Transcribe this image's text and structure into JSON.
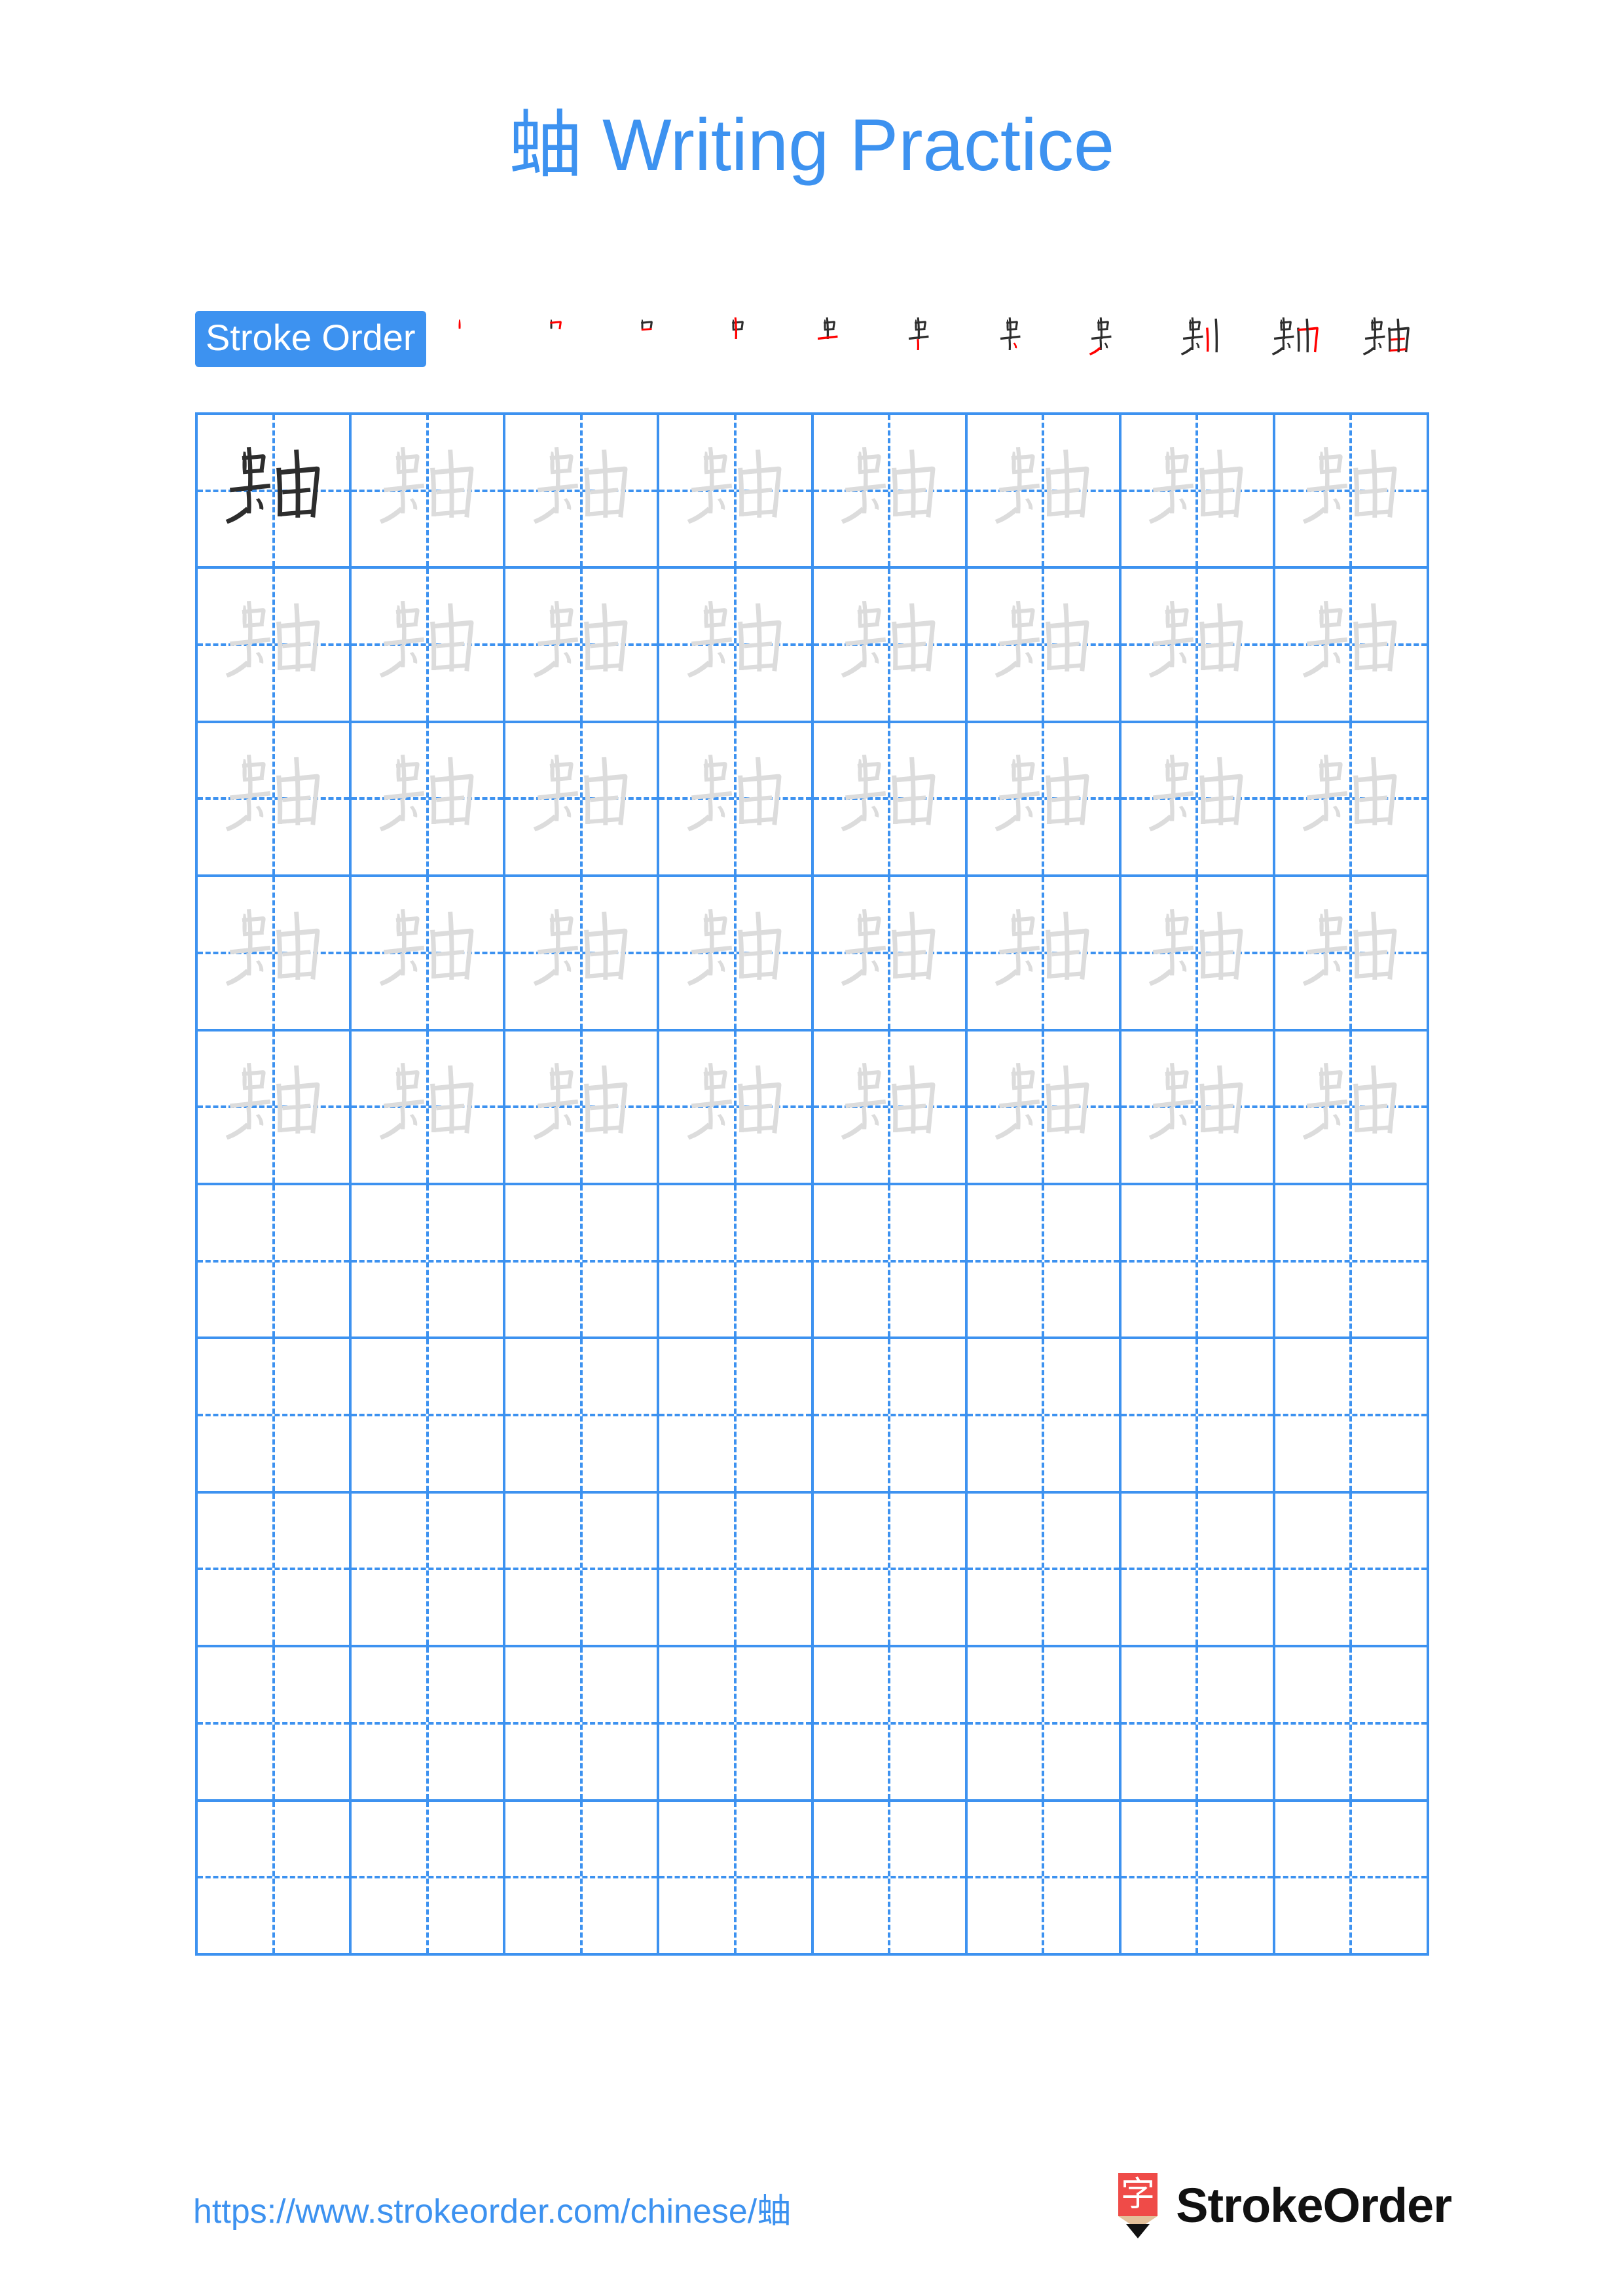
{
  "page": {
    "character": "蚰",
    "title": "蚰 Writing Practice",
    "title_char": "蚰",
    "title_rest": " Writing Practice",
    "background_color": "#ffffff",
    "accent_color": "#3D92F0",
    "trace_color": "#DCDCDC",
    "ink_color": "#2D2D2D",
    "highlight_stroke_color": "#FF0000"
  },
  "stroke_order": {
    "badge_label": "Stroke Order",
    "total_strokes": 11,
    "steps": [
      {
        "index": 1,
        "strokes_shown": 1,
        "new_stroke": 1,
        "glyph": "丨"
      },
      {
        "index": 2,
        "strokes_shown": 2,
        "new_stroke": 2,
        "glyph": "冂"
      },
      {
        "index": 3,
        "strokes_shown": 3,
        "new_stroke": 3,
        "glyph": "口"
      },
      {
        "index": 4,
        "strokes_shown": 4,
        "new_stroke": 4,
        "glyph": "中"
      },
      {
        "index": 5,
        "strokes_shown": 5,
        "new_stroke": 5,
        "glyph": "virtual-5"
      },
      {
        "index": 6,
        "strokes_shown": 6,
        "new_stroke": 6,
        "glyph": "虫"
      },
      {
        "index": 7,
        "strokes_shown": 7,
        "new_stroke": 7,
        "glyph": "虫丶"
      },
      {
        "index": 8,
        "strokes_shown": 8,
        "new_stroke": 8,
        "glyph": "蚰-8"
      },
      {
        "index": 9,
        "strokes_shown": 9,
        "new_stroke": 9,
        "glyph": "蚰-9"
      },
      {
        "index": 10,
        "strokes_shown": 10,
        "new_stroke": 10,
        "glyph": "蚰-10"
      },
      {
        "index": 11,
        "strokes_shown": 11,
        "new_stroke": 11,
        "glyph": "蚰"
      }
    ]
  },
  "practice_grid": {
    "columns": 8,
    "rows": 10,
    "guide_line_style": "dashed-cross",
    "cells": [
      [
        "dark",
        "trace",
        "trace",
        "trace",
        "trace",
        "trace",
        "trace",
        "trace"
      ],
      [
        "trace",
        "trace",
        "trace",
        "trace",
        "trace",
        "trace",
        "trace",
        "trace"
      ],
      [
        "trace",
        "trace",
        "trace",
        "trace",
        "trace",
        "trace",
        "trace",
        "trace"
      ],
      [
        "trace",
        "trace",
        "trace",
        "trace",
        "trace",
        "trace",
        "trace",
        "trace"
      ],
      [
        "trace",
        "trace",
        "trace",
        "trace",
        "trace",
        "trace",
        "trace",
        "trace"
      ],
      [
        "empty",
        "empty",
        "empty",
        "empty",
        "empty",
        "empty",
        "empty",
        "empty"
      ],
      [
        "empty",
        "empty",
        "empty",
        "empty",
        "empty",
        "empty",
        "empty",
        "empty"
      ],
      [
        "empty",
        "empty",
        "empty",
        "empty",
        "empty",
        "empty",
        "empty",
        "empty"
      ],
      [
        "empty",
        "empty",
        "empty",
        "empty",
        "empty",
        "empty",
        "empty",
        "empty"
      ],
      [
        "empty",
        "empty",
        "empty",
        "empty",
        "empty",
        "empty",
        "empty",
        "empty"
      ]
    ]
  },
  "footer": {
    "url": "https://www.strokeorder.com/chinese/蚰",
    "brand_name": "StrokeOrder",
    "logo_character": "字",
    "logo_pencil_color": "#EF4B48",
    "logo_wood_color": "#E3C09A",
    "logo_tip_color": "#111111"
  }
}
